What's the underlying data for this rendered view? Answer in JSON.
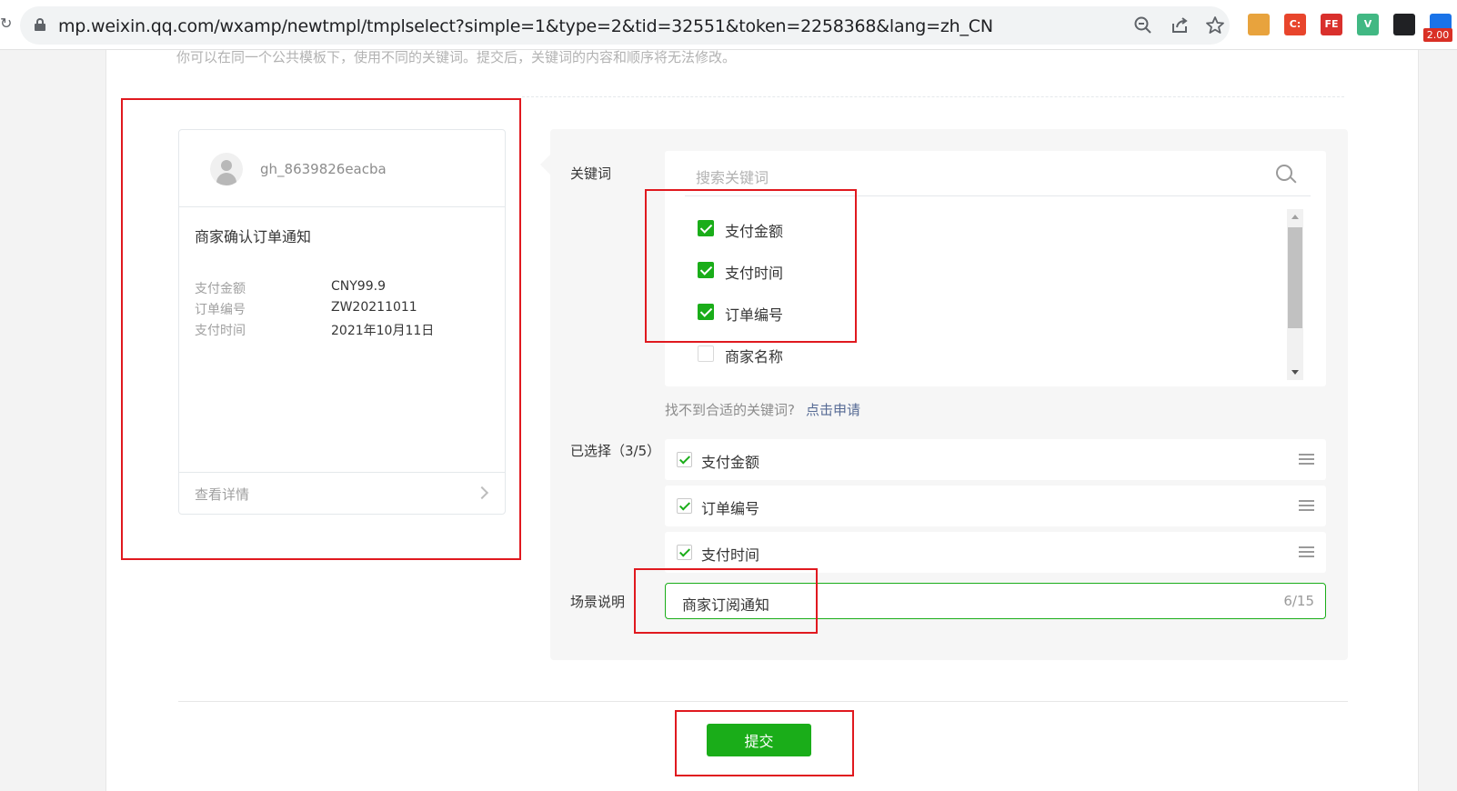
{
  "browser": {
    "url": "mp.weixin.qq.com/wxamp/newtmpl/tmplselect?simple=1&type=2&tid=32551&token=2258368&lang=zh_CN",
    "extensions": [
      {
        "name": "translate-extension-icon",
        "label": "",
        "color": "#e8a33d"
      },
      {
        "name": "c-extension-icon",
        "label": "C:",
        "color": "#e8452c"
      },
      {
        "name": "fe-extension-icon",
        "label": "FE",
        "color": "#d9302c"
      },
      {
        "name": "vue-devtools-icon",
        "label": "V",
        "color": "#41b883"
      },
      {
        "name": "glasses-extension-icon",
        "label": "",
        "color": "#202124"
      },
      {
        "name": "flag-extension-icon",
        "label": "",
        "color": "#1a73e8"
      }
    ],
    "badge": "2.00"
  },
  "page": {
    "hint": "你可以在同一个公共模板下，使用不同的关键词。提交后，关键词的内容和顺序将无法修改。"
  },
  "preview": {
    "account": "gh_8639826eacba",
    "title": "商家确认订单通知",
    "fields": [
      {
        "key": "支付金额",
        "value": "CNY99.9"
      },
      {
        "key": "订单编号",
        "value": "ZW20211011"
      },
      {
        "key": "支付时间",
        "value": "2021年10月11日"
      }
    ],
    "detail_link": "查看详情"
  },
  "form": {
    "keywords_label": "关键词",
    "search_placeholder": "搜索关键词",
    "options": [
      {
        "label": "支付金额",
        "checked": true
      },
      {
        "label": "支付时间",
        "checked": true
      },
      {
        "label": "订单编号",
        "checked": true
      },
      {
        "label": "商家名称",
        "checked": false
      }
    ],
    "not_found_text": "找不到合适的关键词?",
    "apply_link": "点击申请",
    "selected_label": "已选择（3/5）",
    "selected": [
      "支付金额",
      "订单编号",
      "支付时间"
    ],
    "scene_label": "场景说明",
    "scene_value": "商家订阅通知",
    "scene_count": "6/15"
  },
  "actions": {
    "submit": "提交"
  },
  "colors": {
    "primary_green": "#1aad19",
    "link_blue": "#576b95",
    "annotation_red": "#e0191f"
  }
}
